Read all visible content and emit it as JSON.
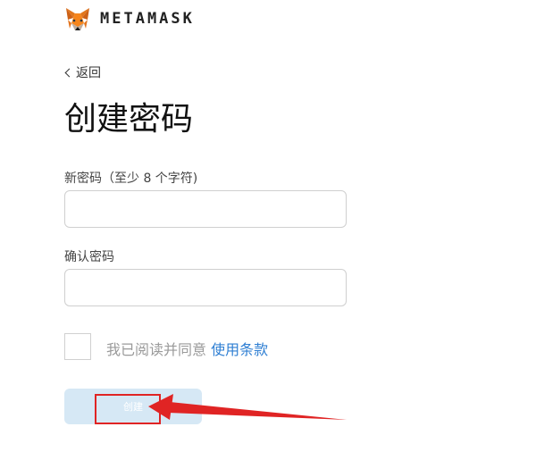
{
  "brand": {
    "name": "METAMASK",
    "logo_icon": "metamask-fox-icon"
  },
  "nav": {
    "back_label": "返回",
    "back_icon": "chevron-left-icon"
  },
  "page": {
    "title": "创建密码"
  },
  "form": {
    "new_password": {
      "label": "新密码（至少 8 个字符)",
      "value": ""
    },
    "confirm_password": {
      "label": "确认密码",
      "value": ""
    },
    "agree": {
      "text": "我已阅读并同意",
      "link_text": "使用条款",
      "checked": false
    },
    "create_button_label": "创建"
  },
  "colors": {
    "link": "#2f7fd3",
    "button_bg_disabled": "#d6e8f5",
    "annotation_red": "#e02424"
  }
}
